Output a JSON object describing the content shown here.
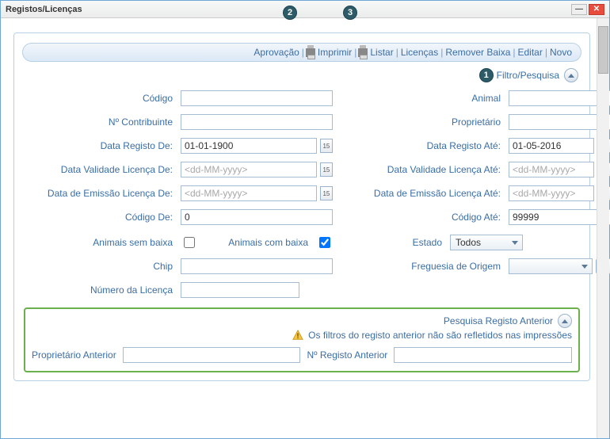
{
  "window": {
    "title": "Registos/Licenças"
  },
  "badges": {
    "b1": "1",
    "b2": "2",
    "b3": "3"
  },
  "actionbar": {
    "aprovacao": "Aprovação",
    "imprimir": "Imprimir",
    "listar": "Listar",
    "licencas": "Licenças",
    "remover_baixa": "Remover Baixa",
    "editar": "Editar",
    "novo": "Novo"
  },
  "filter": {
    "label": "Filtro/Pesquisa"
  },
  "labels": {
    "codigo": "Código",
    "animal": "Animal",
    "contribuinte": "Nº Contribuinte",
    "proprietario": "Proprietário",
    "data_registo_de": "Data Registo De:",
    "data_registo_ate": "Data Registo Até:",
    "data_validade_de": "Data Validade Licença De:",
    "data_validade_ate": "Data Validade Licença Até:",
    "data_emissao_de": "Data de Emissão Licença De:",
    "data_emissao_ate": "Data de Emissão Licença Até:",
    "codigo_de": "Código De:",
    "codigo_ate": "Código Até:",
    "animais_sem_baixa": "Animais sem baixa",
    "animais_com_baixa": "Animais com baixa",
    "estado": "Estado",
    "chip": "Chip",
    "freguesia": "Freguesia de Origem",
    "numero_licenca": "Número da Licença"
  },
  "values": {
    "data_registo_de": "01-01-1900",
    "data_registo_ate": "01-05-2016",
    "codigo_de": "0",
    "codigo_ate": "99999",
    "estado": "Todos"
  },
  "placeholders": {
    "date": "<dd-MM-yyyy>"
  },
  "date_btn": "15",
  "anterior": {
    "title": "Pesquisa Registo Anterior",
    "warning": "Os filtros do registo anterior não são refletidos nas impressões",
    "proprietario": "Proprietário Anterior",
    "registo": "Nº Registo Anterior"
  }
}
